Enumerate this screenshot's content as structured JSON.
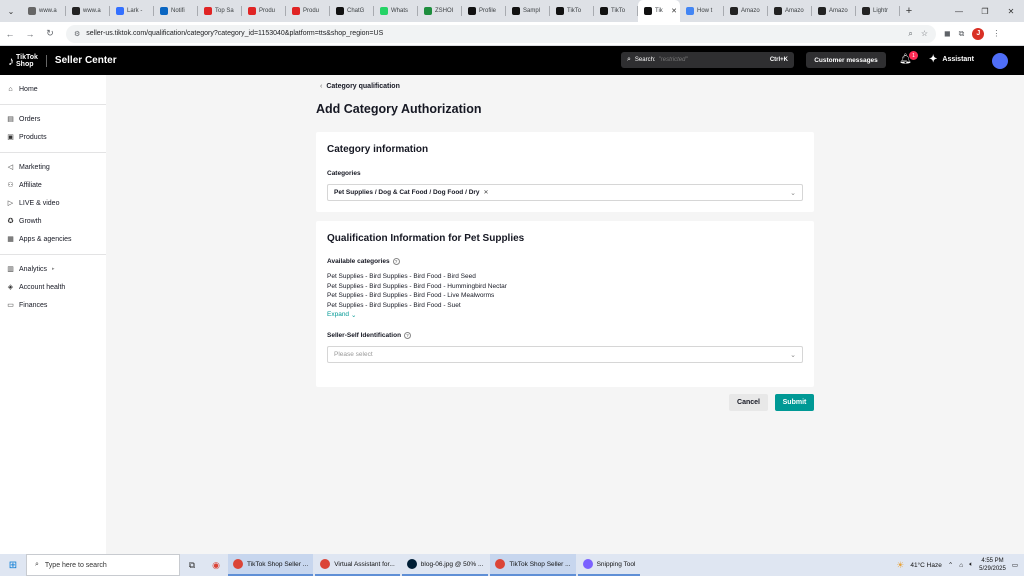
{
  "browser": {
    "tabs": [
      {
        "label": "www.a",
        "color": "#666666"
      },
      {
        "label": "www.a",
        "color": "#222222"
      },
      {
        "label": "Lark -",
        "color": "#3370ff"
      },
      {
        "label": "Notifi",
        "color": "#0a66c2"
      },
      {
        "label": "Top Sa",
        "color": "#e02424"
      },
      {
        "label": "Produ",
        "color": "#e02424"
      },
      {
        "label": "Produ",
        "color": "#e02424"
      },
      {
        "label": "ChatG",
        "color": "#111111"
      },
      {
        "label": "Whats",
        "color": "#25d366"
      },
      {
        "label": "ZSHOI",
        "color": "#1e8e3e"
      },
      {
        "label": "Profile",
        "color": "#111111"
      },
      {
        "label": "Sampl",
        "color": "#111111"
      },
      {
        "label": "TikTo",
        "color": "#111111"
      },
      {
        "label": "TikTo",
        "color": "#111111"
      },
      {
        "label": "Tik",
        "color": "#111111",
        "active": true
      },
      {
        "label": "How t",
        "color": "#4285f4"
      },
      {
        "label": "Amazo",
        "color": "#222222"
      },
      {
        "label": "Amazo",
        "color": "#222222"
      },
      {
        "label": "Amazo",
        "color": "#222222"
      },
      {
        "label": "Lightr",
        "color": "#222222"
      }
    ],
    "url": "seller-us.tiktok.com/qualification/category?category_id=1153040&platform=tts&shop_region=US",
    "profile_initial": "J"
  },
  "header": {
    "logo_line1": "TikTok",
    "logo_line2": "Shop",
    "title": "Seller Center",
    "search_label": "Search:",
    "search_placeholder": "\"restricted\"",
    "search_shortcut": "Ctrl+K",
    "customer_messages": "Customer messages",
    "notification_count": "1",
    "assistant": "Assistant"
  },
  "sidebar": {
    "groups": [
      [
        {
          "label": "Home",
          "icon": "home-icon"
        }
      ],
      [
        {
          "label": "Orders",
          "icon": "orders-icon"
        },
        {
          "label": "Products",
          "icon": "products-icon"
        }
      ],
      [
        {
          "label": "Marketing",
          "icon": "megaphone-icon"
        },
        {
          "label": "Affiliate",
          "icon": "people-icon"
        },
        {
          "label": "LIVE & video",
          "icon": "video-icon"
        },
        {
          "label": "Growth",
          "icon": "growth-icon"
        },
        {
          "label": "Apps & agencies",
          "icon": "apps-icon"
        }
      ],
      [
        {
          "label": "Analytics",
          "icon": "analytics-icon",
          "caret": true
        },
        {
          "label": "Account health",
          "icon": "shield-icon"
        },
        {
          "label": "Finances",
          "icon": "wallet-icon"
        }
      ]
    ]
  },
  "main": {
    "breadcrumb": "Category qualification",
    "page_title": "Add Category Authorization",
    "category_card": {
      "title": "Category information",
      "field_label": "Categories",
      "selected": "Pet Supplies / Dog & Cat Food / Dog Food / Dry"
    },
    "qualification_card": {
      "title": "Qualification Information for Pet Supplies",
      "available_label": "Available categories",
      "available": [
        "Pet Supplies - Bird Supplies - Bird Food - Bird Seed",
        "Pet Supplies - Bird Supplies - Bird Food - Hummingbird Nectar",
        "Pet Supplies - Bird Supplies - Bird Food - Live Mealworms",
        "Pet Supplies - Bird Supplies - Bird Food - Suet"
      ],
      "expand": "Expand",
      "self_id_label": "Seller-Self Identification",
      "self_id_placeholder": "Please select"
    },
    "cancel": "Cancel",
    "submit": "Submit"
  },
  "taskbar": {
    "search_placeholder": "Type here to search",
    "apps": [
      {
        "label": "TikTok Shop Seller ...",
        "color": "#db4437",
        "active": true
      },
      {
        "label": "Virtual Assistant for...",
        "color": "#db4437",
        "active": false
      },
      {
        "label": "blog-06.jpg @ 50% ...",
        "color": "#001e36",
        "active": false
      },
      {
        "label": "TikTok Shop Seller ...",
        "color": "#db4437",
        "active": true
      },
      {
        "label": "Snipping Tool",
        "color": "#7b61ff",
        "active": false
      }
    ],
    "weather": "41°C  Haze",
    "time": "4:55 PM",
    "date": "5/29/2025"
  }
}
